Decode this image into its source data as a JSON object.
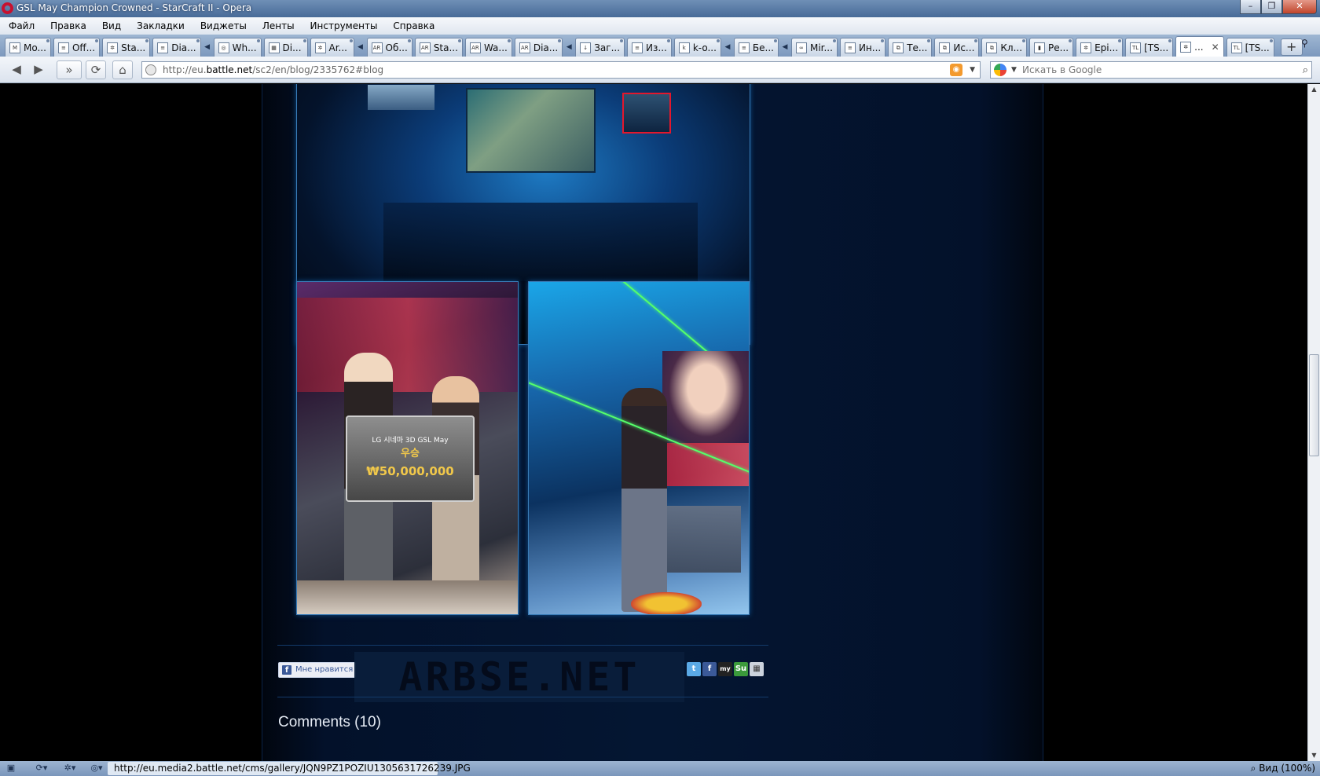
{
  "window": {
    "title": "GSL May Champion Crowned - StarCraft II - Opera"
  },
  "menu": [
    "Файл",
    "Правка",
    "Вид",
    "Закладки",
    "Виджеты",
    "Ленты",
    "Инструменты",
    "Справка"
  ],
  "tabs": [
    {
      "label": "Mo...",
      "icon": "M"
    },
    {
      "label": "Off...",
      "icon": "≡"
    },
    {
      "label": "Sta...",
      "icon": "✲"
    },
    {
      "label": "Dia...",
      "icon": "≡"
    },
    {
      "label": "Wh...",
      "icon": "◎"
    },
    {
      "label": "Di...",
      "icon": "▦"
    },
    {
      "label": "Ar...",
      "icon": "✲"
    },
    {
      "label": "Об...",
      "icon": "AR"
    },
    {
      "label": "Sta...",
      "icon": "AR"
    },
    {
      "label": "Wa...",
      "icon": "AR"
    },
    {
      "label": "Dia...",
      "icon": "AR"
    },
    {
      "label": "Заг...",
      "icon": "↓"
    },
    {
      "label": "Из...",
      "icon": "≡"
    },
    {
      "label": "k-o...",
      "icon": "k"
    },
    {
      "label": "Бе...",
      "icon": "≡"
    },
    {
      "label": "Mir...",
      "icon": "∞"
    },
    {
      "label": "Ин...",
      "icon": "≡"
    },
    {
      "label": "Те...",
      "icon": "⧉"
    },
    {
      "label": "Ис...",
      "icon": "⧉"
    },
    {
      "label": "Кл...",
      "icon": "⧉"
    },
    {
      "label": "Ре...",
      "icon": "▮"
    },
    {
      "label": "Epi...",
      "icon": "✲"
    },
    {
      "label": "[TS...",
      "icon": "TL"
    },
    {
      "label": "...",
      "icon": "✲",
      "active": true
    },
    {
      "label": "[TS...",
      "icon": "TL"
    }
  ],
  "address": {
    "url_prefix": "http://eu.",
    "url_domain": "battle.net",
    "url_suffix": "/sc2/en/blog/2335762#blog",
    "search_placeholder": "Искать в Google"
  },
  "page": {
    "check": {
      "line1": "LG 시네마 3D GSL May",
      "winner": "우승",
      "prize": "₩50,000,000"
    },
    "like_label": "Мне нравится",
    "watermark": "ARBSE.NET",
    "comments_heading": "Comments (10)"
  },
  "share": [
    "twitter-icon",
    "facebook-icon",
    "myspace-icon",
    "stumbleupon-icon",
    "more-share-icon"
  ],
  "status": {
    "url": "http://eu.media2.battle.net/cms/gallery/JQN9PZ1POZIU1305631726239.JPG",
    "zoom": "Вид (100%)"
  }
}
